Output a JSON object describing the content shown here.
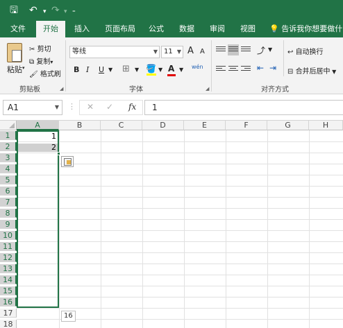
{
  "quick_access": {
    "save": "🖫",
    "undo": "↶",
    "redo": "↷",
    "dropdown": "▾",
    "customize": "₌"
  },
  "tabs": [
    "文件",
    "开始",
    "插入",
    "页面布局",
    "公式",
    "数据",
    "审阅",
    "视图"
  ],
  "active_tab": "开始",
  "tell_me": "告诉我你想要做什么",
  "clipboard": {
    "paste": "粘贴",
    "cut": "剪切",
    "copy": "复制",
    "format_painter": "格式刷",
    "group_label": "剪贴板"
  },
  "font": {
    "name": "等线",
    "size": "11",
    "bold": "B",
    "italic": "I",
    "underline": "U",
    "group_label": "字体",
    "grow": "A",
    "shrink": "A",
    "phonetic": "wén"
  },
  "alignment": {
    "wrap_text": "自动换行",
    "merge_center": "合并后居中",
    "group_label": "对齐方式"
  },
  "formula_bar": {
    "name_box": "A1",
    "cancel": "✕",
    "enter": "✓",
    "fx": "fx",
    "value": "1"
  },
  "columns": [
    "A",
    "B",
    "C",
    "D",
    "E",
    "F",
    "G",
    "H"
  ],
  "rows": [
    "1",
    "2",
    "3",
    "4",
    "5",
    "6",
    "7",
    "8",
    "9",
    "10",
    "11",
    "12",
    "13",
    "14",
    "15",
    "16",
    "17",
    "18"
  ],
  "cells": {
    "A1": "1",
    "A2": "2"
  },
  "autofill_tooltip": "16",
  "colors": {
    "brand_green": "#217346",
    "ribbon_bg": "#f3f3f3"
  }
}
